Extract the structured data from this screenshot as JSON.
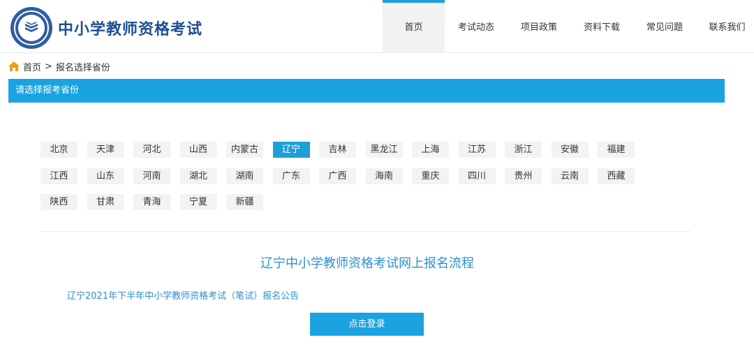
{
  "header": {
    "site_title": "中小学教师资格考试",
    "logo_icon": "education-emblem-logo"
  },
  "nav": {
    "items": [
      {
        "label": "首页",
        "active": true
      },
      {
        "label": "考试动态",
        "active": false
      },
      {
        "label": "项目政策",
        "active": false
      },
      {
        "label": "资料下载",
        "active": false
      },
      {
        "label": "常见问题",
        "active": false
      },
      {
        "label": "联系我们",
        "active": false
      }
    ]
  },
  "breadcrumb": {
    "icon": "home-icon",
    "home": "首页",
    "separator": ">",
    "current": "报名选择省份"
  },
  "section": {
    "title": "请选择报考省份"
  },
  "provinces": [
    "北京",
    "天津",
    "河北",
    "山西",
    "内蒙古",
    "辽宁",
    "吉林",
    "黑龙江",
    "上海",
    "江苏",
    "浙江",
    "安徽",
    "福建",
    "江西",
    "山东",
    "河南",
    "湖北",
    "湖南",
    "广东",
    "广西",
    "海南",
    "重庆",
    "四川",
    "贵州",
    "云南",
    "西藏",
    "陕西",
    "甘肃",
    "青海",
    "宁夏",
    "新疆"
  ],
  "selected_province": "辽宁",
  "content": {
    "flow_title": "辽宁中小学教师资格考试网上报名流程",
    "notice_link": "辽宁2021年下半年中小学教师资格考试（笔试）报名公告",
    "login_button": "点击登录"
  },
  "colors": {
    "accent": "#1aa3e0",
    "brand_title": "#1f4e93",
    "link": "#2d8fcf"
  }
}
